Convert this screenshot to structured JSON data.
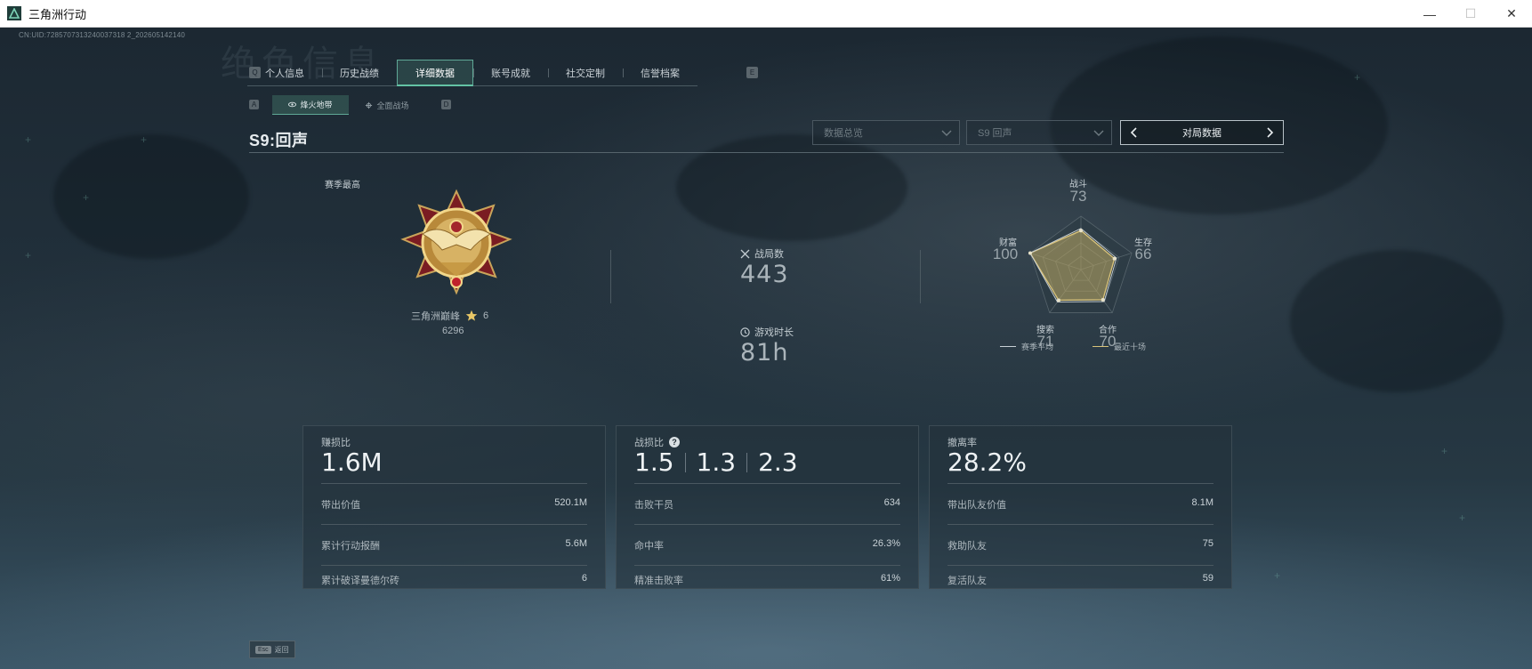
{
  "window": {
    "title": "三角洲行动",
    "minimize": "—",
    "maximize": "☐",
    "close": "✕"
  },
  "uid": "CN:UID:7285707313240037318 2_202605142140",
  "ghost_title": "绝色信息",
  "tabs": {
    "prev_key": "Q",
    "next_key": "E",
    "items": [
      "个人信息",
      "历史战绩",
      "详细数据",
      "账号成就",
      "社交定制",
      "信誉档案"
    ],
    "active_index": 2
  },
  "sub_tabs": {
    "prev_key": "A",
    "next_key": "D",
    "items": [
      "烽火地带",
      "全面战场"
    ],
    "active_index": 0
  },
  "season": {
    "title": "S9:回声"
  },
  "filters": {
    "data_scope": "数据总览",
    "season_select": "S9 回声",
    "match_data": "对局数据"
  },
  "rank": {
    "label": "赛季最高",
    "name": "三角洲巅峰",
    "stars": "6",
    "points": "6296"
  },
  "summary": {
    "matches_label": "战局数",
    "matches_value": "443",
    "playtime_label": "游戏时长",
    "playtime_value": "81h"
  },
  "radar": {
    "axes": [
      {
        "label": "战斗",
        "value": 73
      },
      {
        "label": "生存",
        "value": 66
      },
      {
        "label": "合作",
        "value": 70
      },
      {
        "label": "搜索",
        "value": 71
      },
      {
        "label": "财富",
        "value": 100
      }
    ],
    "legend_average": "赛季平均",
    "legend_recent": "最近十场",
    "average_color": "#c9d1d6",
    "recent_color": "#d8c27a"
  },
  "panels": [
    {
      "title": "赚损比",
      "big": "1.6M",
      "rows": [
        {
          "label": "带出价值",
          "value": "520.1M"
        },
        {
          "label": "累计行动报酬",
          "value": "5.6M"
        },
        {
          "label": "累计破译曼德尔砖",
          "value": "6"
        }
      ]
    },
    {
      "title": "战损比",
      "big_values": [
        "1.5",
        "1.3",
        "2.3"
      ],
      "rows": [
        {
          "label": "击败干员",
          "value": "634"
        },
        {
          "label": "命中率",
          "value": "26.3%"
        },
        {
          "label": "精准击败率",
          "value": "61%"
        }
      ]
    },
    {
      "title": "撤离率",
      "big": "28.2%",
      "rows": [
        {
          "label": "带出队友价值",
          "value": "8.1M"
        },
        {
          "label": "救助队友",
          "value": "75"
        },
        {
          "label": "复活队友",
          "value": "59"
        }
      ]
    }
  ],
  "footer": {
    "esc_key": "Esc",
    "esc_label": "返回"
  },
  "colors": {
    "accent": "#5fa896",
    "gold": "#d8c27a"
  }
}
